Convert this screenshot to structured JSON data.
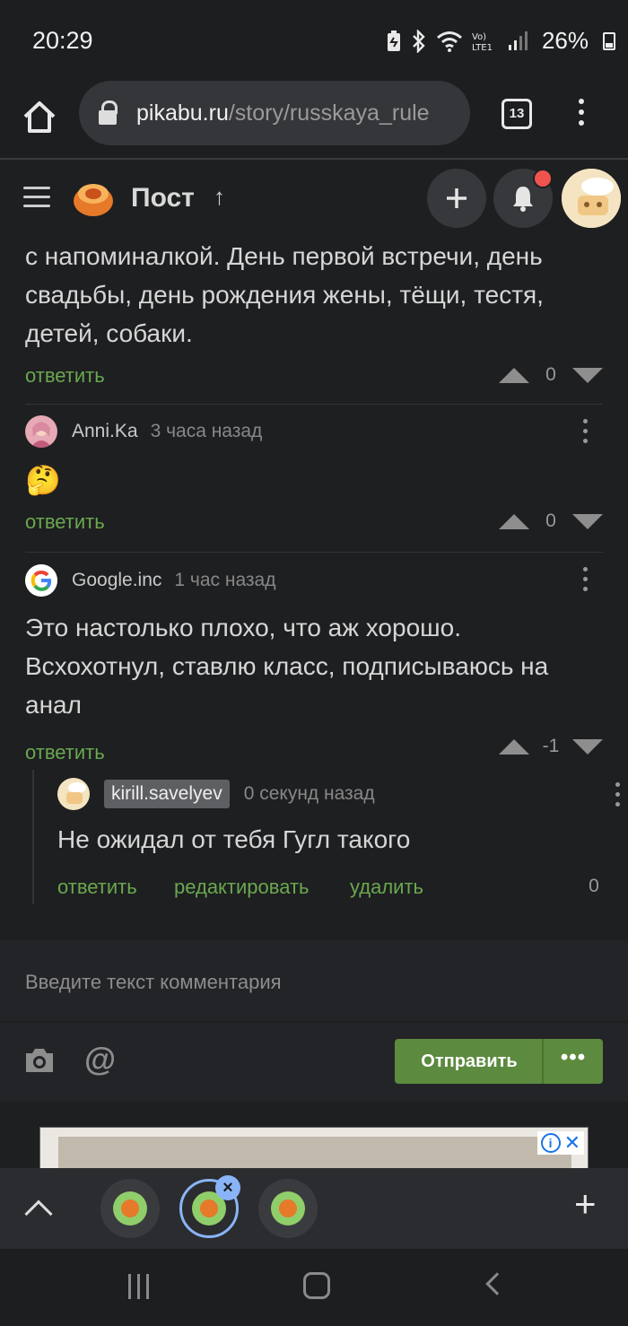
{
  "status_bar": {
    "time": "20:29",
    "battery": "26%"
  },
  "browser": {
    "url_domain": "pikabu.ru",
    "url_path": "/story/russkaya_rule",
    "tab_count": "13"
  },
  "site_header": {
    "title": "Пост",
    "up_arrow": "↑"
  },
  "comments": [
    {
      "text": "с напоминалкой.  День первой встречи, день свадьбы, день рождения жены, тёщи, тестя, детей, собаки.",
      "reply_label": "ответить",
      "votes": "0"
    },
    {
      "author": "Anni.Ka",
      "time": "3 часа назад",
      "emoji": "🤔",
      "reply_label": "ответить",
      "votes": "0"
    },
    {
      "author": "Google.inc",
      "time": "1 час назад",
      "text": "Это настолько плохо, что аж хорошо. Всхохотнул, ставлю класс, подписываюсь на анал",
      "reply_label": "ответить",
      "votes": "-1"
    }
  ],
  "reply": {
    "author": "kirill.savelyev",
    "time": "0 секунд назад",
    "text": "Не ожидал от тебя Гугл такого",
    "reply_label": "ответить",
    "edit_label": "редактировать",
    "delete_label": "удалить",
    "votes": "0"
  },
  "composer": {
    "placeholder": "Введите текст комментария",
    "at_symbol": "@",
    "send_label": "Отправить",
    "more_label": "•••"
  },
  "ad": {
    "info": "i",
    "close": "✕"
  },
  "tab_strip": {
    "close": "×",
    "plus": "+"
  },
  "colors": {
    "accent_green": "#6aa84f",
    "send_button": "#5c8a3e",
    "notification": "#f0544f",
    "active_tab": "#8ab4f8"
  }
}
